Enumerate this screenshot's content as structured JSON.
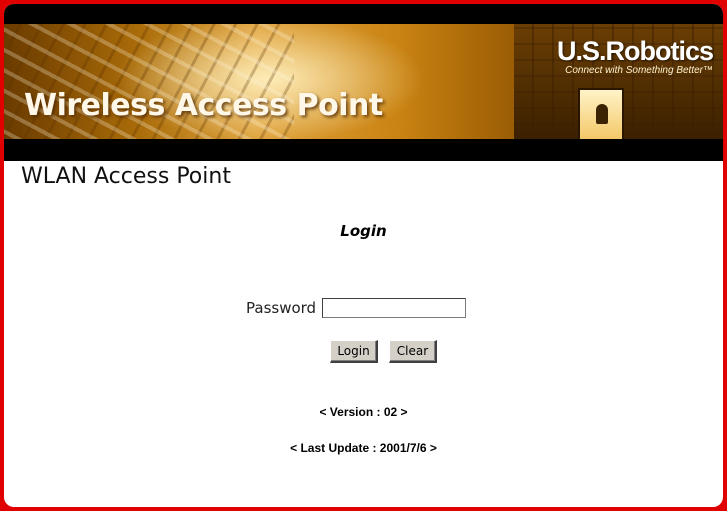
{
  "banner": {
    "title": "Wireless Access Point",
    "brand_name": "U.S.Robotics",
    "brand_tagline": "Connect with Something Better™"
  },
  "page": {
    "title": "WLAN Access Point",
    "login_heading": "Login"
  },
  "form": {
    "password_label": "Password",
    "password_value": "",
    "login_button": "Login",
    "clear_button": "Clear"
  },
  "info": {
    "version": "< Version : 02 >",
    "last_update": "< Last Update : 2001/7/6 >"
  },
  "colors": {
    "frame": "#e00000",
    "banner_accent": "#c98312",
    "bar": "#000000"
  }
}
